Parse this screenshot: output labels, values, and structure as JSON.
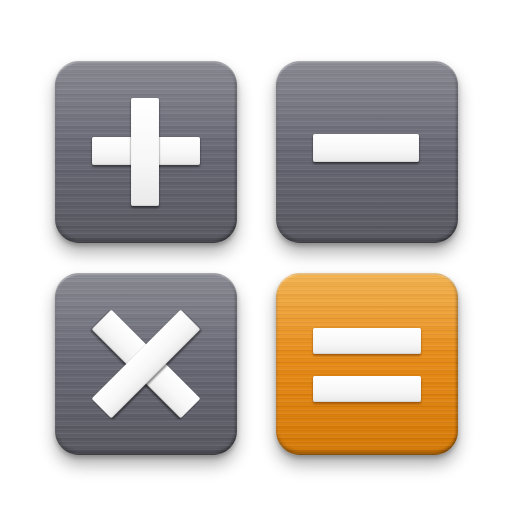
{
  "keypad": {
    "keys": [
      {
        "name": "plus",
        "symbol": "+",
        "color": "#6b6c76"
      },
      {
        "name": "minus",
        "symbol": "−",
        "color": "#6b6c76"
      },
      {
        "name": "multiply",
        "symbol": "×",
        "color": "#6b6c76"
      },
      {
        "name": "equals",
        "symbol": "=",
        "color": "#e88a15"
      }
    ],
    "symbol_color": "#ffffff",
    "background_color": "#ffffff"
  }
}
